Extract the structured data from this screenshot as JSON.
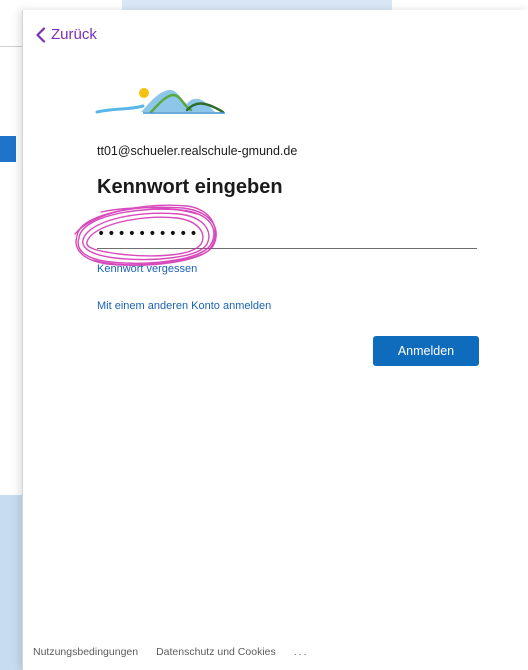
{
  "nav": {
    "back_label": "Zurück"
  },
  "account": {
    "email": "tt01@schueler.realschule-gmund.de"
  },
  "form": {
    "title": "Kennwort eingeben",
    "password_value": "••••••••••",
    "forgot_label": "Kennwort vergessen",
    "other_account_label": "Mit einem anderen Konto anmelden",
    "signin_label": "Anmelden"
  },
  "footer": {
    "terms_label": "Nutzungsbedingungen",
    "privacy_label": "Datenschutz und Cookies",
    "more_label": "..."
  },
  "colors": {
    "accent": "#0f6cbd",
    "link": "#1a63b5",
    "back": "#7b2fb5",
    "annotation": "#d12bb0"
  },
  "icons": {
    "back": "chevron-left-icon",
    "logo": "school-logo-icon"
  }
}
